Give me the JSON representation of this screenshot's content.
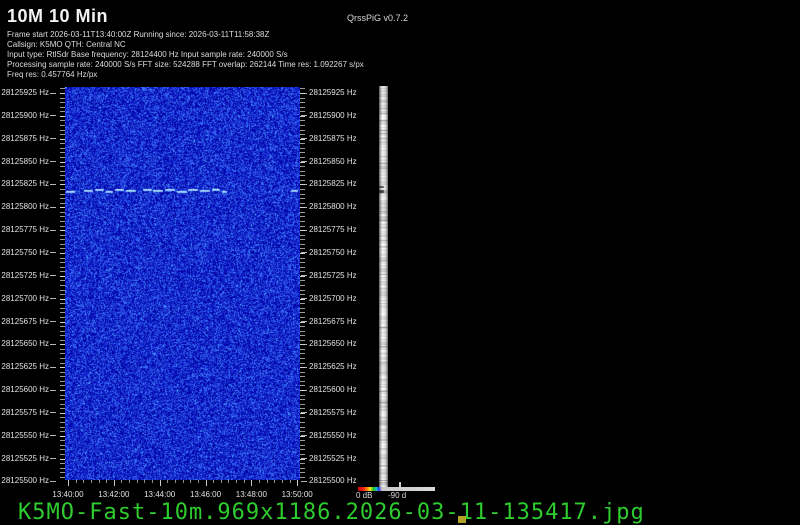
{
  "header": {
    "title": "10M 10 Min",
    "version": "QrssPiG v0.7.2",
    "info_lines": [
      "Frame start 2026-03-11T13:40:00Z Running since: 2026-03-11T11:58:38Z",
      "Callsign: K5MO QTH: Central NC",
      "Input type: RtlSdr Base frequency: 28124400 Hz Input sample rate: 240000 S/s",
      "Processing sample rate: 240000 S/s FFT size: 524288 FFT overlap: 262144 Time res: 1.092267 s/px",
      "Freq res: 0.457764 Hz/px"
    ]
  },
  "chart_data": {
    "type": "heatmap",
    "subtype": "QRSS waterfall spectrogram with side spectrum bar",
    "title": "10M 10 Min",
    "x_axis": {
      "unit": "UTC time",
      "tick_labels": [
        "13:40:00",
        "13:42:00",
        "13:44:00",
        "13:46:00",
        "13:48:00",
        "13:50:00"
      ],
      "major_step": "2 min",
      "minor_step": "20 s",
      "range": [
        "13:40:00",
        "13:50:00"
      ]
    },
    "y_axis": {
      "unit": "Hz",
      "tick_labels": [
        "28125925 Hz",
        "28125900 Hz",
        "28125875 Hz",
        "28125850 Hz",
        "28125825 Hz",
        "28125800 Hz",
        "28125775 Hz",
        "28125750 Hz",
        "28125725 Hz",
        "28125700 Hz",
        "28125675 Hz",
        "28125650 Hz",
        "28125625 Hz",
        "28125600 Hz",
        "28125575 Hz",
        "28125550 Hz",
        "28125525 Hz",
        "28125500 Hz"
      ],
      "top_hz": 28125925,
      "bottom_hz": 28125500,
      "major_step_hz": 25,
      "minor_step_hz": 5
    },
    "signals": [
      {
        "frequency_hz": 28125820,
        "time_start": "13:40:00",
        "time_end": "13:46:50",
        "style": "dashed QRSS CW trace",
        "color": "#91d2fa"
      },
      {
        "frequency_hz": 28125820,
        "time_start": "13:49:40",
        "time_end": "13:50:00",
        "style": "short dash",
        "color": "#91d2fa"
      }
    ],
    "db_scale": {
      "left": "0 dB",
      "right": "-90 d"
    },
    "colors": {
      "background": "#000000",
      "waterfall_noise_floor": "#1628c8",
      "signal_trace": "#91d2fa",
      "spectrum_bar": "#c9c9c9",
      "axis_text": "#e2e2e2"
    }
  },
  "footer": {
    "filename": "K5MO-Fast-10m.969x1186.2026-03-11-135417.jpg",
    "filename_color": "#2ecc2e",
    "cursor_color": "#b3a226"
  }
}
